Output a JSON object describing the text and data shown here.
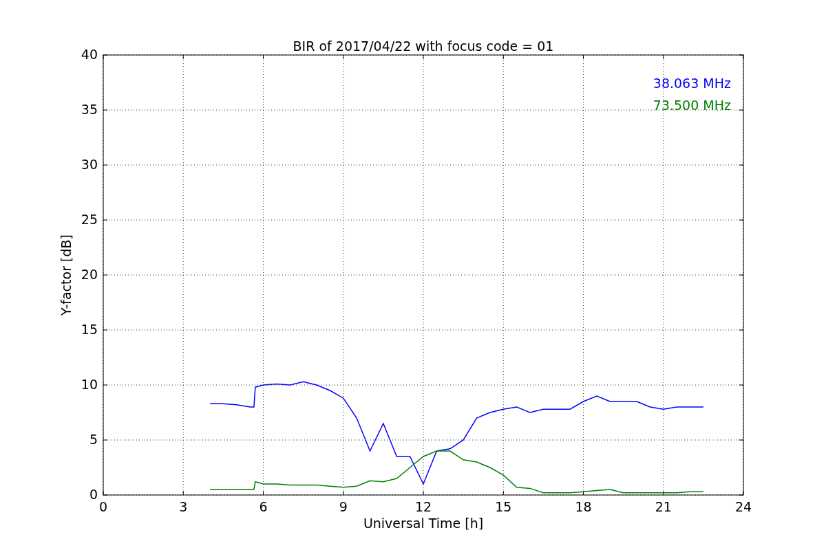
{
  "chart_data": {
    "type": "line",
    "title": "BIR of 2017/04/22 with focus code = 01",
    "xlabel": "Universal Time [h]",
    "ylabel": "Y-factor [dB]",
    "x": [
      4.0,
      4.5,
      5.0,
      5.5,
      5.65,
      5.7,
      6.0,
      6.5,
      7.0,
      7.5,
      8.0,
      8.5,
      9.0,
      9.5,
      10.0,
      10.5,
      11.0,
      11.5,
      12.0,
      12.5,
      13.0,
      13.5,
      14.0,
      14.5,
      15.0,
      15.5,
      16.0,
      16.5,
      17.0,
      17.5,
      18.0,
      18.5,
      19.0,
      19.5,
      20.0,
      20.5,
      21.0,
      21.5,
      22.0,
      22.5
    ],
    "series": [
      {
        "name": "38.063 MHz",
        "color": "#0000ff",
        "values": [
          8.3,
          8.3,
          8.2,
          8.0,
          8.0,
          9.8,
          10.0,
          10.1,
          10.0,
          10.3,
          10.0,
          9.5,
          8.8,
          7.0,
          4.0,
          6.5,
          3.5,
          3.5,
          1.0,
          4.0,
          4.2,
          5.0,
          7.0,
          7.5,
          7.8,
          8.0,
          7.5,
          7.8,
          7.8,
          7.8,
          8.5,
          9.0,
          8.5,
          8.5,
          8.5,
          8.0,
          7.8,
          8.0,
          8.0,
          8.0
        ]
      },
      {
        "name": "73.500 MHz",
        "color": "#008000",
        "values": [
          0.5,
          0.5,
          0.5,
          0.5,
          0.5,
          1.2,
          1.0,
          1.0,
          0.9,
          0.9,
          0.9,
          0.8,
          0.7,
          0.8,
          1.3,
          1.2,
          1.5,
          2.5,
          3.5,
          4.0,
          4.0,
          3.2,
          3.0,
          2.5,
          1.8,
          0.7,
          0.6,
          0.2,
          0.2,
          0.2,
          0.3,
          0.4,
          0.5,
          0.2,
          0.2,
          0.2,
          0.2,
          0.2,
          0.3,
          0.3
        ]
      }
    ],
    "xlim": [
      0,
      24
    ],
    "ylim": [
      0,
      40
    ],
    "xticks": [
      0,
      3,
      6,
      9,
      12,
      15,
      18,
      21,
      24
    ],
    "yticks": [
      0,
      5,
      10,
      15,
      20,
      25,
      30,
      35,
      40
    ],
    "grid": true
  }
}
